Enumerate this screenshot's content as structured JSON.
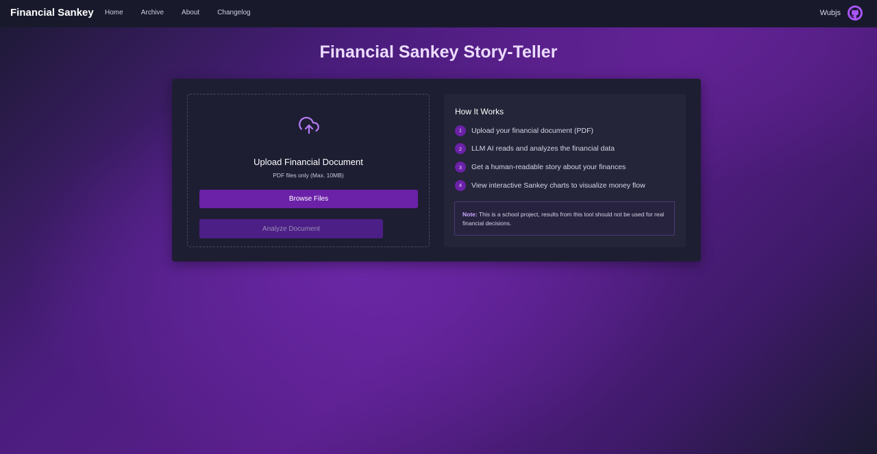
{
  "nav": {
    "brand": "Financial Sankey",
    "links": [
      "Home",
      "Archive",
      "About",
      "Changelog"
    ],
    "user": "Wubjs",
    "github_icon": "github-icon"
  },
  "page": {
    "title": "Financial Sankey Story-Teller"
  },
  "upload": {
    "icon": "cloud-upload-icon",
    "title": "Upload Financial Document",
    "subtitle": "PDF files only (Max. 10MB)",
    "browse_label": "Browse Files",
    "analyze_label": "Analyze Document"
  },
  "how": {
    "title": "How It Works",
    "steps": [
      {
        "num": "1",
        "text": "Upload your financial document (PDF)"
      },
      {
        "num": "2",
        "text": "LLM AI reads and analyzes the financial data"
      },
      {
        "num": "3",
        "text": "Get a human-readable story about your finances"
      },
      {
        "num": "4",
        "text": "View interactive Sankey charts to visualize money flow"
      }
    ],
    "note_label": "Note:",
    "note_text": " This is a school project, results from this tool should not be used for real financial decisions."
  },
  "colors": {
    "accent": "#6b21a8",
    "accent_light": "#a855f7",
    "navbar": "#181a2c",
    "card": "#1e1e33"
  }
}
